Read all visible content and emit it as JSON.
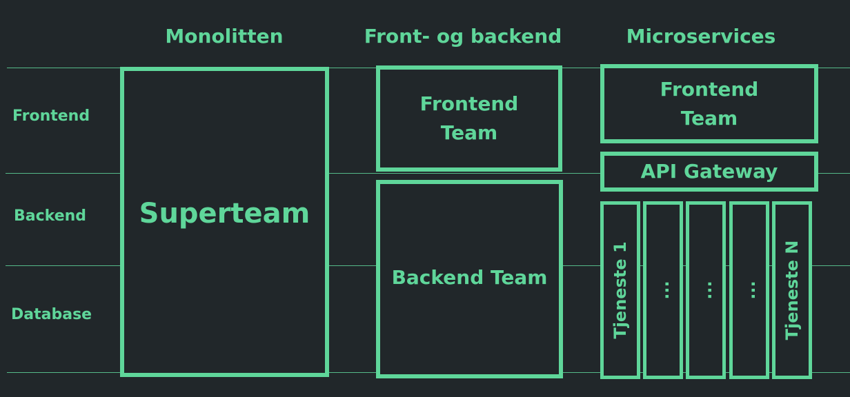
{
  "columns": {
    "monolith": "Monolitten",
    "front_back": "Front- og backend",
    "microservices": "Microservices"
  },
  "rows": {
    "frontend": "Frontend",
    "backend": "Backend",
    "database": "Database"
  },
  "monolith": {
    "team": "Superteam"
  },
  "front_back": {
    "frontend_team": "Frontend\nTeam",
    "backend_team": "Backend Team"
  },
  "microservices": {
    "frontend_team": "Frontend\nTeam",
    "api_gateway": "API Gateway",
    "services": [
      "Tjeneste 1",
      "...",
      "...",
      "...",
      "Tjeneste N"
    ]
  },
  "colors": {
    "background": "#21272a",
    "accent": "#5fd69a"
  }
}
